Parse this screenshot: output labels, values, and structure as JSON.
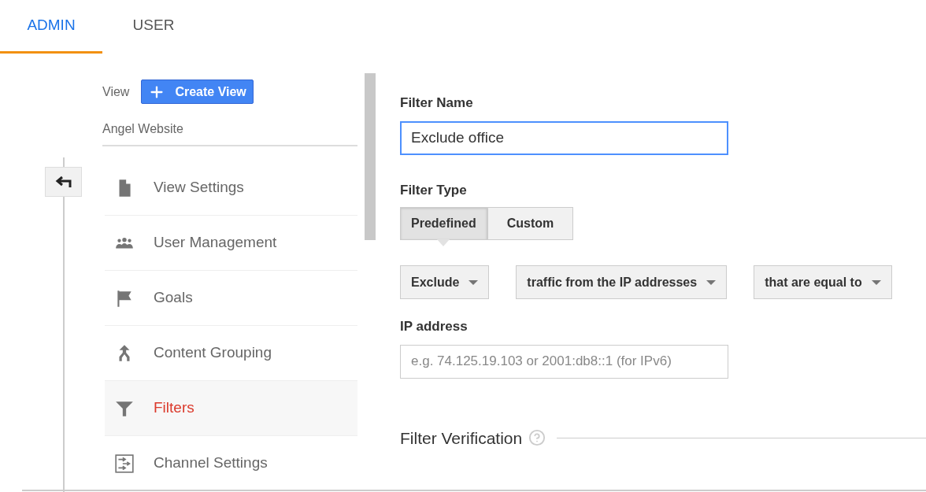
{
  "tabs": [
    {
      "label": "ADMIN",
      "selected": true
    },
    {
      "label": "USER",
      "selected": false
    }
  ],
  "sidebar": {
    "label": "View",
    "create_button": "Create View",
    "view_name": "Angel Website",
    "items": [
      {
        "label": "View Settings",
        "selected": false
      },
      {
        "label": "User Management",
        "selected": false
      },
      {
        "label": "Goals",
        "selected": false
      },
      {
        "label": "Content Grouping",
        "selected": false
      },
      {
        "label": "Filters",
        "selected": true
      },
      {
        "label": "Channel Settings",
        "selected": false
      }
    ]
  },
  "form": {
    "filter_name": {
      "label": "Filter Name",
      "value": "Exclude office"
    },
    "filter_type": {
      "label": "Filter Type",
      "options": [
        {
          "label": "Predefined",
          "selected": true
        },
        {
          "label": "Custom",
          "selected": false
        }
      ]
    },
    "conditions": [
      "Exclude",
      "traffic from the IP addresses",
      "that are equal to"
    ],
    "ip_address": {
      "label": "IP address",
      "placeholder": "e.g. 74.125.19.103 or 2001:db8::1 (for IPv6)"
    },
    "verification": {
      "title": "Filter Verification"
    }
  }
}
